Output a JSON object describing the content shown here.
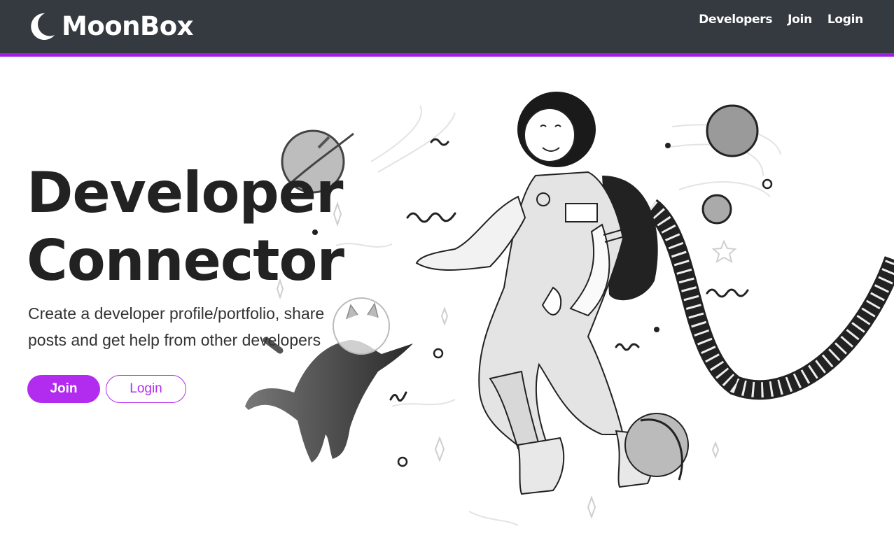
{
  "navbar": {
    "brand": "MoonBox",
    "brand_icon": "moon-icon",
    "links": [
      "Developers",
      "Join",
      "Login"
    ]
  },
  "hero": {
    "title_line1": "Developer",
    "title_line2": "Connector",
    "lead_line1": "Create a developer profile/portfolio, share",
    "lead_line2": "posts and get help from other developers",
    "join_button": "Join",
    "login_button": "Login"
  },
  "illustration": {
    "subject": "astronaut-and-cat-in-space-illustration"
  },
  "colors": {
    "navbar_bg": "#343a40",
    "accent": "#a21ee0",
    "button": "#b22cf0",
    "text_dark": "#222222"
  }
}
